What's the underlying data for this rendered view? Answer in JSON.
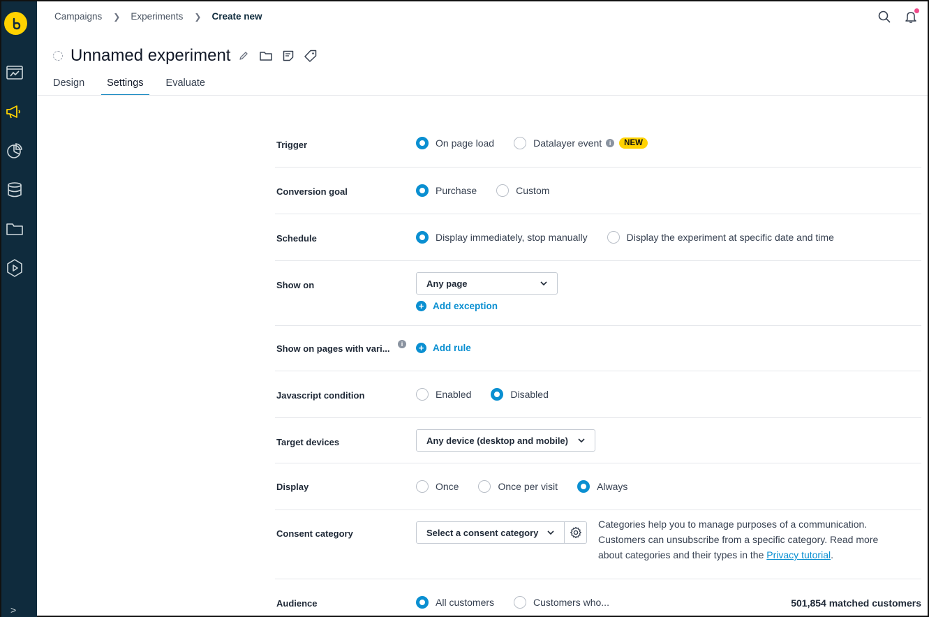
{
  "breadcrumb": {
    "items": [
      "Campaigns",
      "Experiments"
    ],
    "current": "Create new"
  },
  "page": {
    "title": "Unnamed experiment"
  },
  "tabs": [
    {
      "label": "Design"
    },
    {
      "label": "Settings"
    },
    {
      "label": "Evaluate"
    }
  ],
  "colors": {
    "accent": "#0a8fd1",
    "sidebar": "#0f2b3d",
    "brand": "#ffd200",
    "notification": "#ef4a8a"
  },
  "sidebar": {
    "icons": [
      "dashboard-icon",
      "megaphone-icon",
      "pie-chart-icon",
      "database-icon",
      "folder-icon",
      "play-hexagon-icon"
    ]
  },
  "settings": {
    "trigger": {
      "label": "Trigger",
      "options": [
        "On page load",
        "Datalayer event"
      ],
      "selected": "On page load",
      "badge": "NEW"
    },
    "conversion_goal": {
      "label": "Conversion goal",
      "options": [
        "Purchase",
        "Custom"
      ],
      "selected": "Purchase"
    },
    "schedule": {
      "label": "Schedule",
      "options": [
        "Display immediately, stop manually",
        "Display the experiment at specific date and time"
      ],
      "selected": "Display immediately, stop manually"
    },
    "show_on": {
      "label": "Show on",
      "value": "Any page",
      "add_label": "Add exception"
    },
    "show_on_pages": {
      "label": "Show on pages with vari...",
      "add_label": "Add rule"
    },
    "js_condition": {
      "label": "Javascript condition",
      "options": [
        "Enabled",
        "Disabled"
      ],
      "selected": "Disabled"
    },
    "target_devices": {
      "label": "Target devices",
      "value": "Any device (desktop and mobile)"
    },
    "display": {
      "label": "Display",
      "options": [
        "Once",
        "Once per visit",
        "Always"
      ],
      "selected": "Always"
    },
    "consent": {
      "label": "Consent category",
      "placeholder": "Select a consent category",
      "help_text": "Categories help you to manage purposes of a communication. Customers can unsubscribe from a specific category. Read more about categories and their types in the",
      "help_link": "Privacy tutorial",
      "help_end": "."
    },
    "audience": {
      "label": "Audience",
      "options": [
        "All customers",
        "Customers who..."
      ],
      "selected": "All customers",
      "matched": "501,854 matched customers"
    }
  }
}
